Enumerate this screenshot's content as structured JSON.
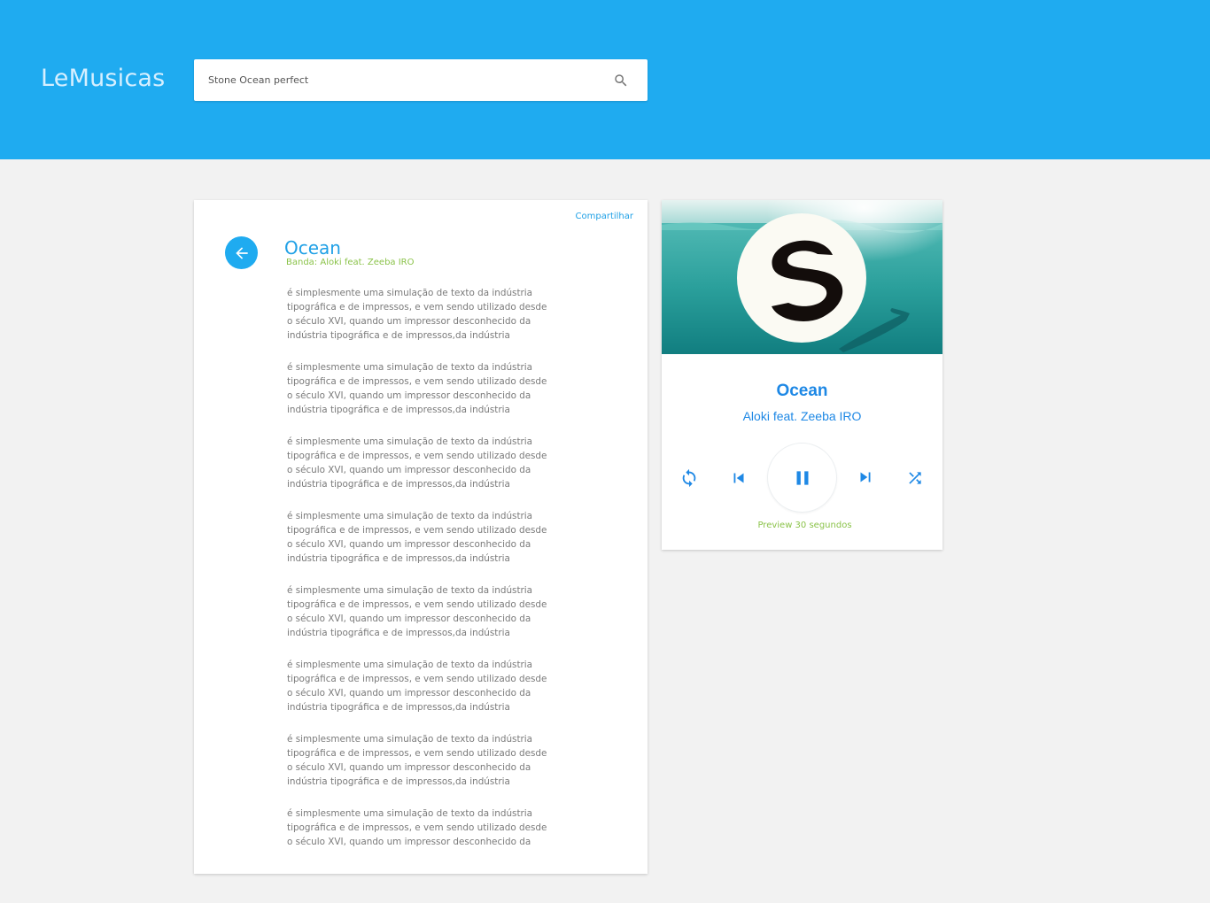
{
  "app": {
    "title": "LeMusicas"
  },
  "search": {
    "value": "Stone Ocean perfect",
    "icon": "search-icon"
  },
  "lyrics_card": {
    "share_label": "Compartilhar",
    "back_icon": "arrow-left-icon",
    "title": "Ocean",
    "band": "Banda: Aloki feat. Zeeba IRO",
    "paragraphs": [
      [
        "é simplesmente uma simulação de texto da indústria",
        "tipográfica e de impressos, e vem sendo utilizado desde",
        "o século XVI, quando um impressor desconhecido da",
        "indústria tipográfica e de impressos,da indústria"
      ],
      [
        "é simplesmente uma simulação de texto da indústria",
        "tipográfica e de impressos, e vem sendo utilizado desde",
        "o século XVI, quando um impressor desconhecido da",
        "indústria tipográfica e de impressos,da indústria"
      ],
      [
        "é simplesmente uma simulação de texto da indústria",
        "tipográfica e de impressos, e vem sendo utilizado desde",
        "o século XVI, quando um impressor desconhecido da",
        "indústria tipográfica e de impressos,da indústria"
      ],
      [
        "é simplesmente uma simulação de texto da indústria",
        "tipográfica e de impressos, e vem sendo utilizado desde",
        "o século XVI, quando um impressor desconhecido da",
        "indústria tipográfica e de impressos,da indústria"
      ],
      [
        "é simplesmente uma simulação de texto da indústria",
        "tipográfica e de impressos, e vem sendo utilizado desde",
        "o século XVI, quando um impressor desconhecido da",
        "indústria tipográfica e de impressos,da indústria"
      ],
      [
        "é simplesmente uma simulação de texto da indústria",
        "tipográfica e de impressos, e vem sendo utilizado desde",
        "o século XVI, quando um impressor desconhecido da",
        "indústria tipográfica e de impressos,da indústria"
      ],
      [
        "é simplesmente uma simulação de texto da indústria",
        "tipográfica e de impressos, e vem sendo utilizado desde",
        "o século XVI, quando um impressor desconhecido da",
        "indústria tipográfica e de impressos,da indústria"
      ],
      [
        "é simplesmente uma simulação de texto da indústria",
        "tipográfica e de impressos, e vem sendo utilizado desde",
        "o século XVI, quando um impressor desconhecido da"
      ]
    ]
  },
  "player": {
    "album_art": "ocean-album-art-with-spinnin-logo",
    "title": "Ocean",
    "artist": "Aloki feat. Zeeba IRO",
    "controls": {
      "repeat_icon": "repeat-icon",
      "previous_icon": "skip-previous-icon",
      "play_state_icon": "pause-icon",
      "next_icon": "skip-next-icon",
      "shuffle_icon": "shuffle-icon"
    },
    "preview_label": "Preview 30 segundos"
  },
  "colors": {
    "header_bg": "#1fabf0",
    "accent_blue": "#1e88e5",
    "link_blue": "#1fa0e6",
    "accent_green": "#8bc34a",
    "page_bg": "#f2f2f2",
    "body_text": "#7a7a7a"
  }
}
